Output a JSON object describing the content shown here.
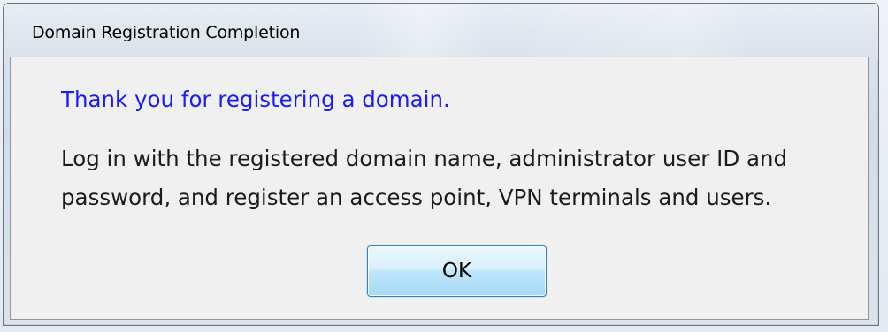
{
  "window": {
    "title": "Domain Registration Completion"
  },
  "dialog": {
    "heading": "Thank you for registering a domain.",
    "message_lines": [
      "Log in with the registered domain name, administrator user ID and",
      "password, and register an access point, VPN terminals and users."
    ],
    "ok_label": "OK"
  },
  "colors": {
    "heading": "#1a1aff",
    "body_text": "#1c1c1c",
    "button_border": "#3c7fb1"
  }
}
